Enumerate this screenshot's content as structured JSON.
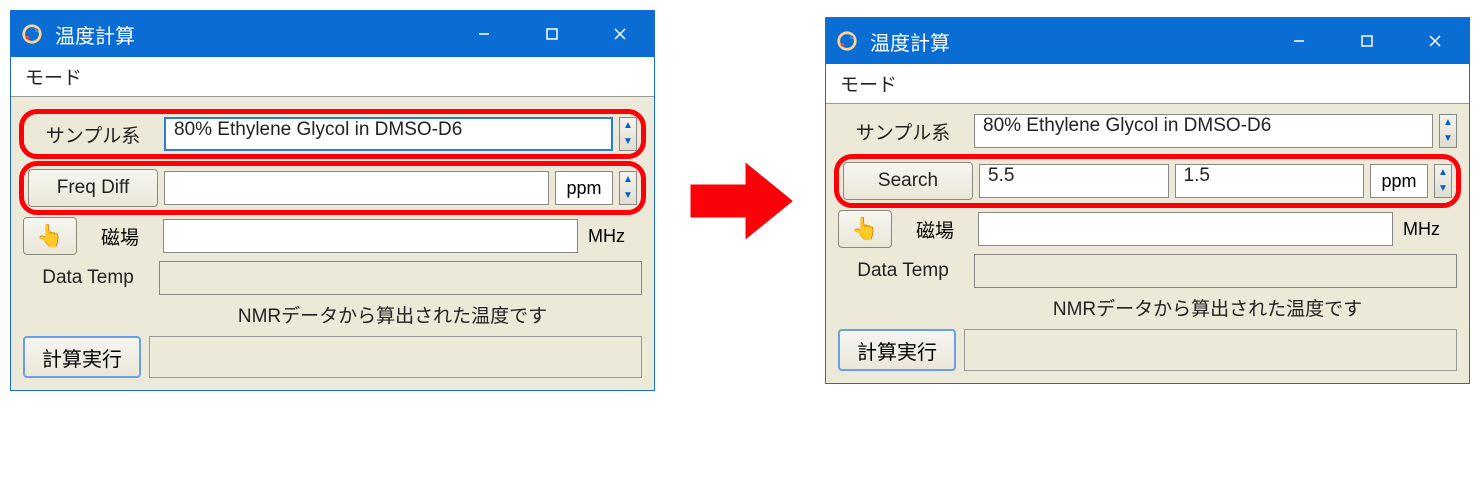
{
  "left": {
    "title": "温度計算",
    "menu": "モード",
    "sample_label": "サンプル系",
    "sample_value": "80% Ethylene Glycol in DMSO-D6",
    "freqdiff_button": "Freq Diff",
    "freqdiff_value": "",
    "freqdiff_unit": "ppm",
    "field_label": "磁場",
    "field_value": "",
    "field_unit": "MHz",
    "datatemp_label": "Data Temp",
    "datatemp_value": "",
    "note": "NMRデータから算出された温度です",
    "calc_button": "計算実行"
  },
  "right": {
    "title": "温度計算",
    "menu": "モード",
    "sample_label": "サンプル系",
    "sample_value": "80% Ethylene Glycol in DMSO-D6",
    "search_button": "Search",
    "search_val1": "5.5",
    "search_val2": "1.5",
    "search_unit": "ppm",
    "field_label": "磁場",
    "field_value": "",
    "field_unit": "MHz",
    "datatemp_label": "Data Temp",
    "datatemp_value": "",
    "note": "NMRデータから算出された温度です",
    "calc_button": "計算実行"
  }
}
